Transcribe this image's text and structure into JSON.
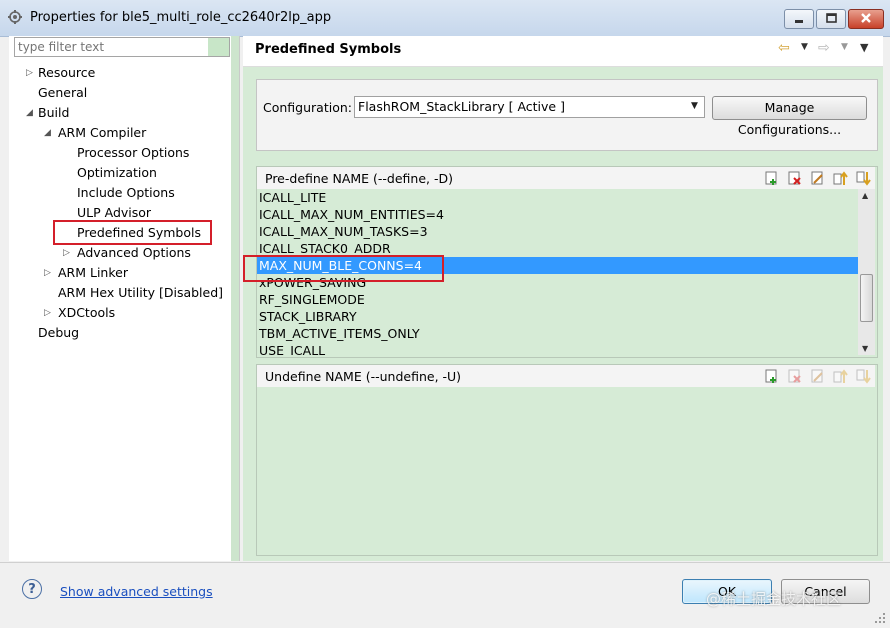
{
  "window": {
    "title": "Properties for ble5_multi_role_cc2640r2lp_app",
    "controls": [
      "minimize-icon",
      "maximize-icon",
      "close-icon"
    ]
  },
  "filter": {
    "placeholder": "type filter text"
  },
  "tree": {
    "items": [
      {
        "label": "Resource",
        "indent": 0,
        "arrow": "▷"
      },
      {
        "label": "General",
        "indent": 0,
        "arrow": ""
      },
      {
        "label": "Build",
        "indent": 0,
        "arrow": "◢"
      },
      {
        "label": "ARM Compiler",
        "indent": 1,
        "arrow": "◢"
      },
      {
        "label": "Processor Options",
        "indent": 2,
        "arrow": ""
      },
      {
        "label": "Optimization",
        "indent": 2,
        "arrow": ""
      },
      {
        "label": "Include Options",
        "indent": 2,
        "arrow": ""
      },
      {
        "label": "ULP Advisor",
        "indent": 2,
        "arrow": ""
      },
      {
        "label": "Predefined Symbols",
        "indent": 2,
        "arrow": "",
        "selected": true
      },
      {
        "label": "Advanced Options",
        "indent": 2,
        "arrow": "▷"
      },
      {
        "label": "ARM Linker",
        "indent": 1,
        "arrow": "▷"
      },
      {
        "label": "ARM Hex Utility  [Disabled]",
        "indent": 1,
        "arrow": ""
      },
      {
        "label": "XDCtools",
        "indent": 1,
        "arrow": "▷"
      },
      {
        "label": "Debug",
        "indent": 0,
        "arrow": ""
      }
    ]
  },
  "page": {
    "title": "Predefined Symbols",
    "nav_icons": [
      "back-arrow-icon",
      "forward-arrow-icon",
      "view-menu-icon"
    ]
  },
  "configuration": {
    "label": "Configuration:",
    "value": "FlashROM_StackLibrary  [ Active ]",
    "manage_button": "Manage Configurations..."
  },
  "predefine": {
    "title": "Pre-define NAME (--define, -D)",
    "toolbar_icons": [
      "add-icon",
      "delete-icon",
      "edit-icon",
      "move-up-icon",
      "move-down-icon"
    ],
    "symbols": [
      "ICALL_LITE",
      "ICALL_MAX_NUM_ENTITIES=4",
      "ICALL_MAX_NUM_TASKS=3",
      "ICALL_STACK0_ADDR",
      "MAX_NUM_BLE_CONNS=4",
      "xPOWER_SAVING",
      "RF_SINGLEMODE",
      "STACK_LIBRARY",
      "TBM_ACTIVE_ITEMS_ONLY",
      "USE_ICALL"
    ],
    "selected_index": 4
  },
  "undefine": {
    "title": "Undefine NAME (--undefine, -U)",
    "toolbar_icons": [
      "add-icon",
      "delete-icon",
      "edit-icon",
      "move-up-icon",
      "move-down-icon"
    ]
  },
  "footer": {
    "help_icon": "?",
    "advanced_link": "Show advanced settings",
    "ok_label": "OK",
    "cancel_label": "Cancel",
    "watermark": "@稀土掘金技术社区"
  },
  "colors": {
    "panel_bg": "#d6ebd6",
    "selection": "#3399ff",
    "highlight_border": "#d41f2a",
    "link": "#1a4fbf"
  }
}
